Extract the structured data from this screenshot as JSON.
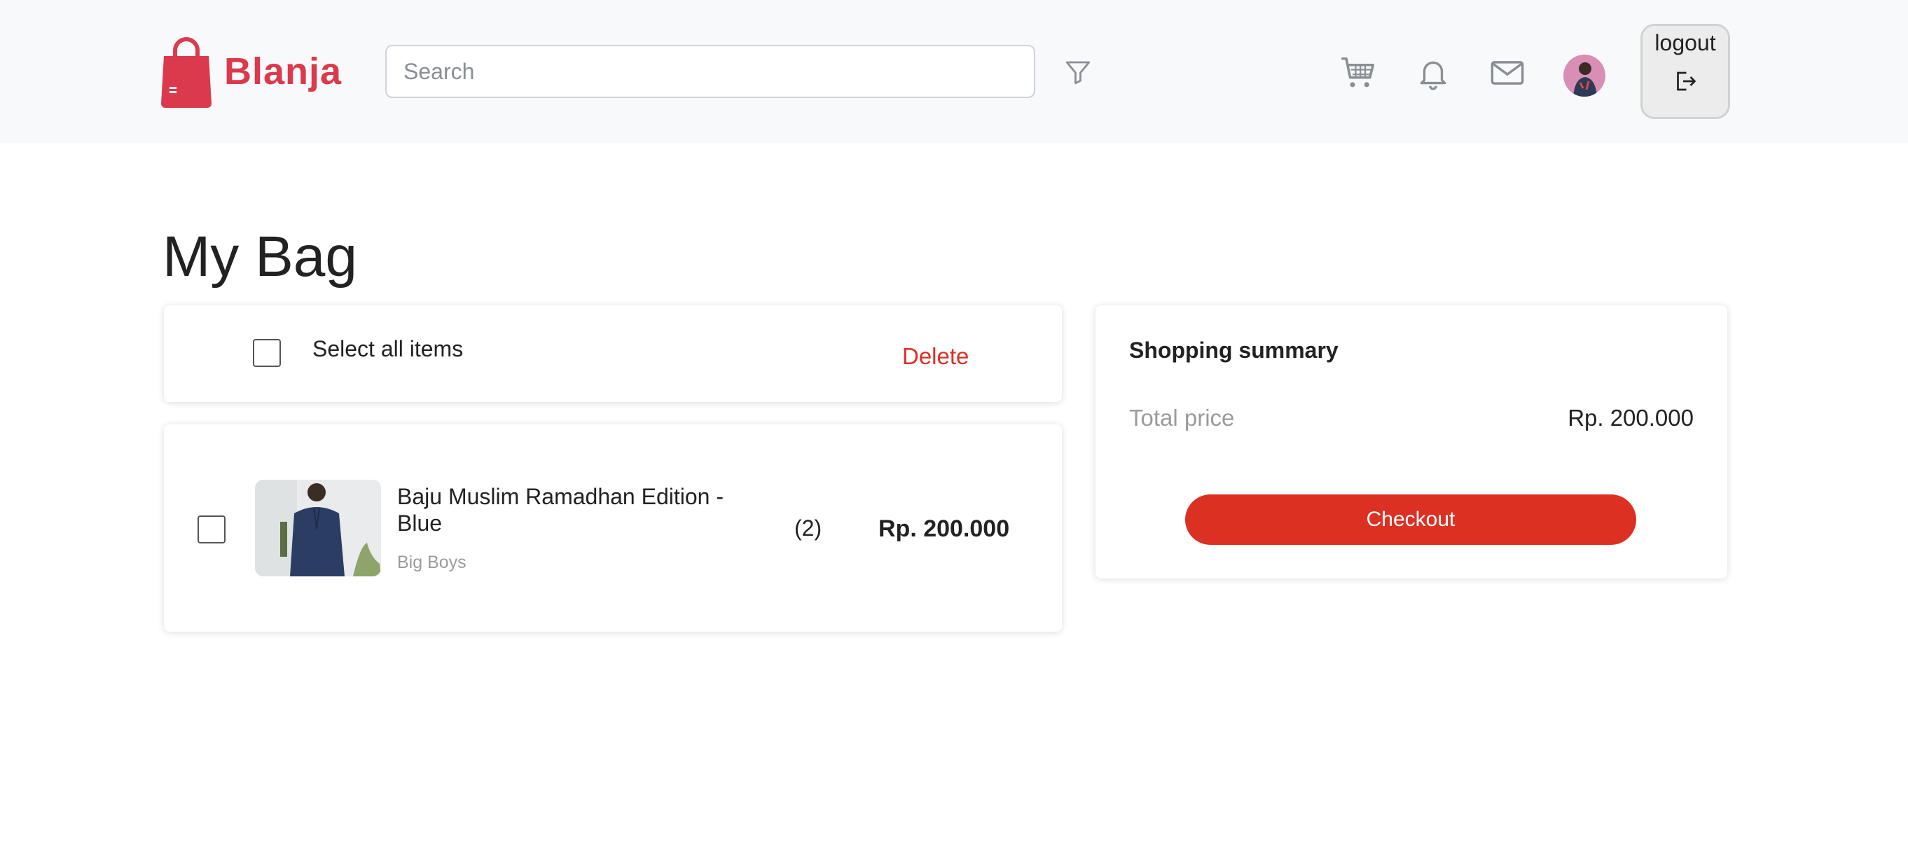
{
  "brand": {
    "name": "Blanja",
    "color": "#db3a4c",
    "logo_icon": "shopping-bag-icon"
  },
  "header": {
    "search_placeholder": "Search",
    "search_value": "",
    "filter_icon": "filter-icon",
    "icons": [
      "cart-icon",
      "bell-icon",
      "mail-icon"
    ],
    "avatar": "user-avatar",
    "logout_label": "logout",
    "logout_icon": "logout-icon"
  },
  "page": {
    "title": "My Bag"
  },
  "selection": {
    "select_all_label": "Select all items",
    "select_all_checked": false,
    "delete_label": "Delete"
  },
  "cart_items": [
    {
      "name": "Baju Muslim Ramadhan Edition - Blue",
      "store": "Big Boys",
      "quantity": "(2)",
      "price": "Rp. 200.000",
      "checked": false
    }
  ],
  "summary": {
    "title": "Shopping summary",
    "total_label": "Total price",
    "total_value": "Rp. 200.000",
    "checkout_label": "Checkout"
  },
  "colors": {
    "accent": "#db3022",
    "delete": "#d93025",
    "muted": "#9b9b9b"
  }
}
